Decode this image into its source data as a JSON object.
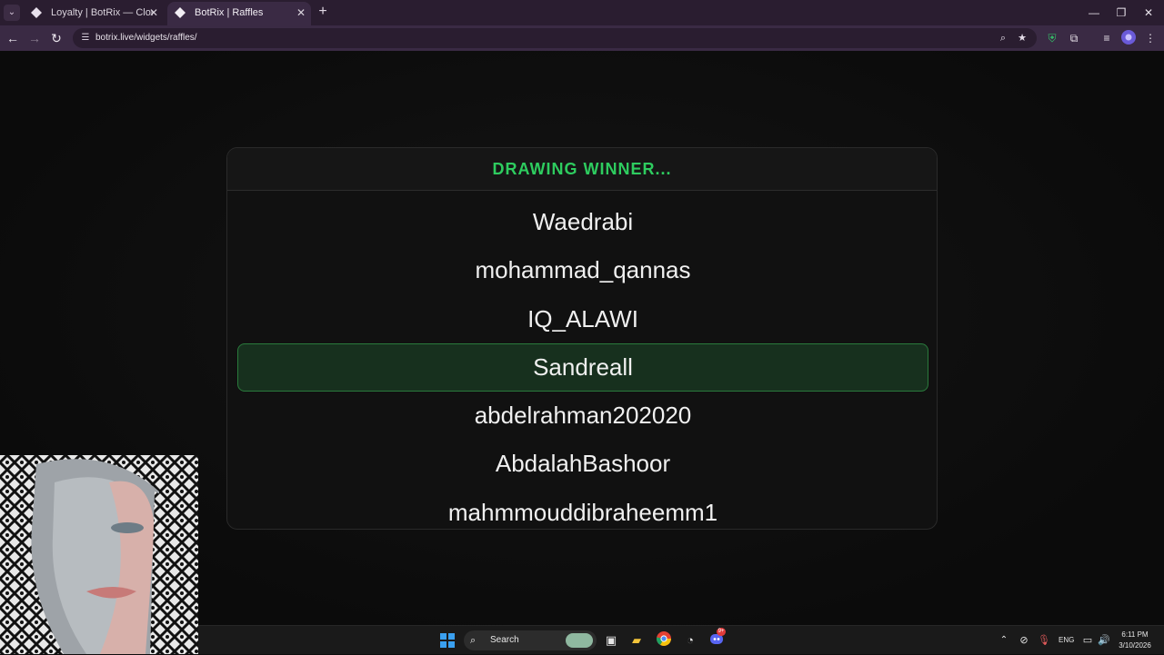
{
  "browser": {
    "tabs": [
      {
        "title": "Loyalty | BotRix — Cloud Stream",
        "active": false
      },
      {
        "title": "BotRix | Raffles",
        "active": true
      }
    ],
    "url": "botrix.live/widgets/raffles/",
    "colors": {
      "frame": "#2a1d30",
      "toolbar": "#3a2a44"
    }
  },
  "raffle": {
    "status": "DRAWING WINNER...",
    "names": [
      "Waedrabi",
      "mohammad_qannas",
      "IQ_ALAWI",
      "Sandreall",
      "abdelrahman202020",
      "AbdalahBashoor",
      "mahmmouddibraheemm1"
    ],
    "selected_index": 3,
    "colors": {
      "accent": "#2ecc5f",
      "selected_bg": "#17301e",
      "selected_border": "#2a7a3c"
    }
  },
  "taskbar": {
    "search_label": "Search",
    "language": "ENG",
    "time": "6:11 PM",
    "date": "3/10/2026",
    "discord_badge": "9+"
  }
}
